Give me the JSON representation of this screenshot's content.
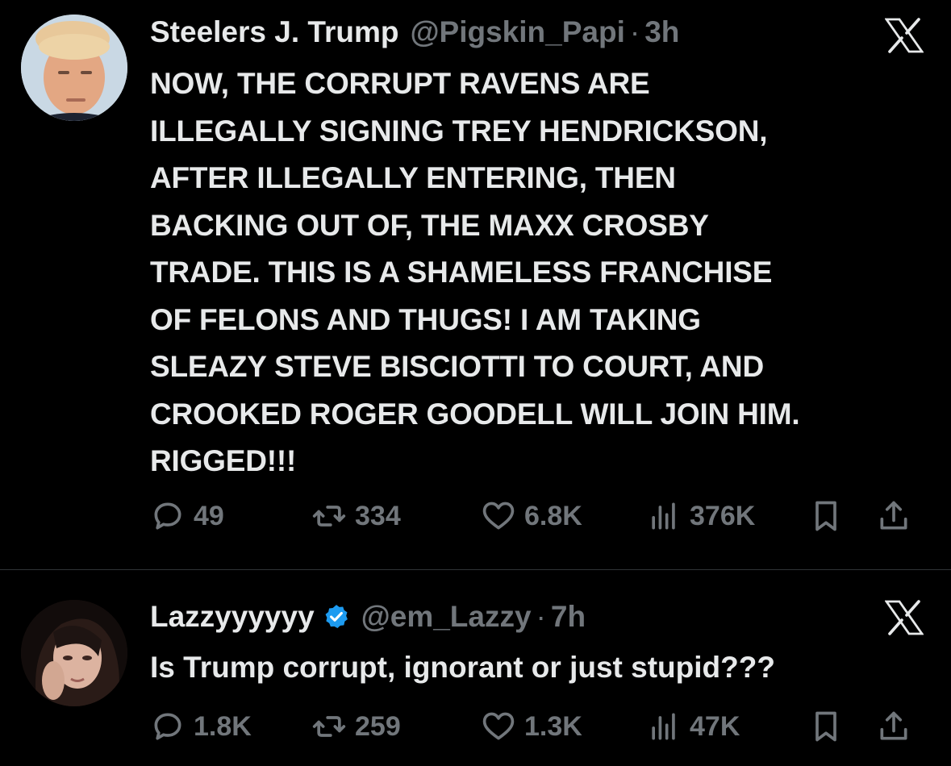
{
  "tweets": [
    {
      "display_name": "Steelers J. Trump",
      "handle": "@Pigskin_Papi",
      "separator": "·",
      "time": "3h",
      "verified": false,
      "lines": [
        "NOW, THE CORRUPT RAVENS ARE",
        "ILLEGALLY SIGNING TREY HENDRICKSON,",
        "AFTER ILLEGALLY ENTERING, THEN",
        "BACKING OUT OF, THE MAXX CROSBY",
        "TRADE. THIS IS A SHAMELESS FRANCHISE",
        "OF FELONS AND THUGS! I AM TAKING",
        "SLEAZY STEVE BISCIOTTI TO COURT, AND",
        "CROOKED ROGER GOODELL WILL JOIN HIM.",
        "RIGGED!!!"
      ],
      "stats": {
        "replies": "49",
        "retweets": "334",
        "likes": "6.8K",
        "views": "376K"
      }
    },
    {
      "display_name": "Lazzyyyyyy",
      "handle": "@em_Lazzy",
      "separator": "·",
      "time": "7h",
      "verified": true,
      "lines": [
        "Is Trump corrupt, ignorant or just stupid???"
      ],
      "stats": {
        "replies": "1.8K",
        "retweets": "259",
        "likes": "1.3K",
        "views": "47K"
      }
    }
  ],
  "icons": {
    "reply": "reply-icon",
    "retweet": "retweet-icon",
    "like": "heart-icon",
    "views": "views-icon",
    "bookmark": "bookmark-icon",
    "share": "share-icon",
    "brand": "x-logo-icon",
    "verified": "verified-badge-icon"
  },
  "colors": {
    "background": "#000000",
    "text": "#e7e9ea",
    "muted": "#71767b",
    "verified": "#1d9bf0",
    "divider": "#2f3336"
  }
}
